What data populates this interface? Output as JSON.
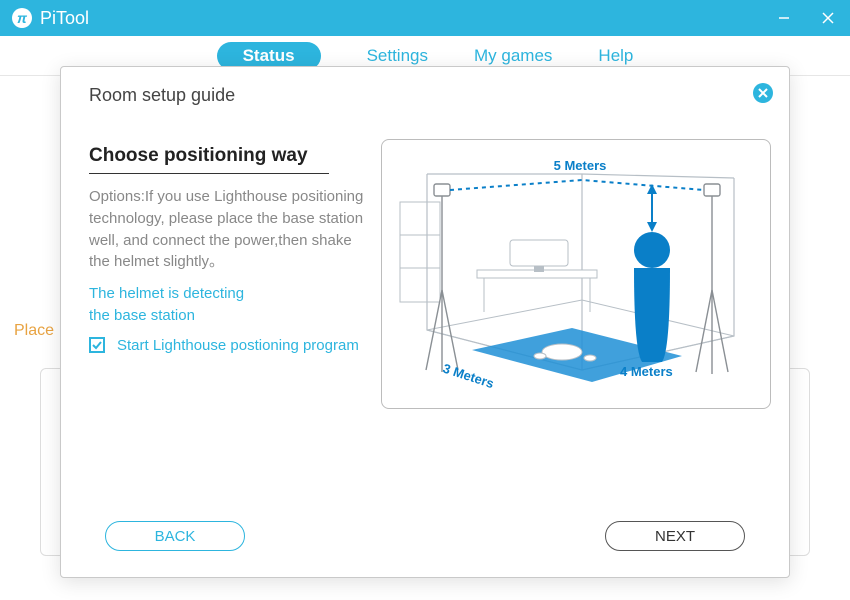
{
  "titlebar": {
    "app_name": "PiTool"
  },
  "nav": {
    "status": "Status",
    "settings": "Settings",
    "mygames": "My games",
    "help": "Help"
  },
  "background": {
    "hint_prefix": "Place"
  },
  "modal": {
    "title": "Room setup guide",
    "heading": "Choose positioning way",
    "body": "Options:If you use Lighthouse positioning technology, please place the base station well, and connect the power,then shake the helmet slightly。",
    "detect_line1": "The helmet is detecting",
    "detect_line2": "the base station",
    "checkbox_label": "Start Lighthouse postioning program",
    "back": "BACK",
    "next": "NEXT",
    "illus": {
      "m5": "5 Meters",
      "m4": "4 Meters",
      "m3": "3 Meters"
    }
  }
}
